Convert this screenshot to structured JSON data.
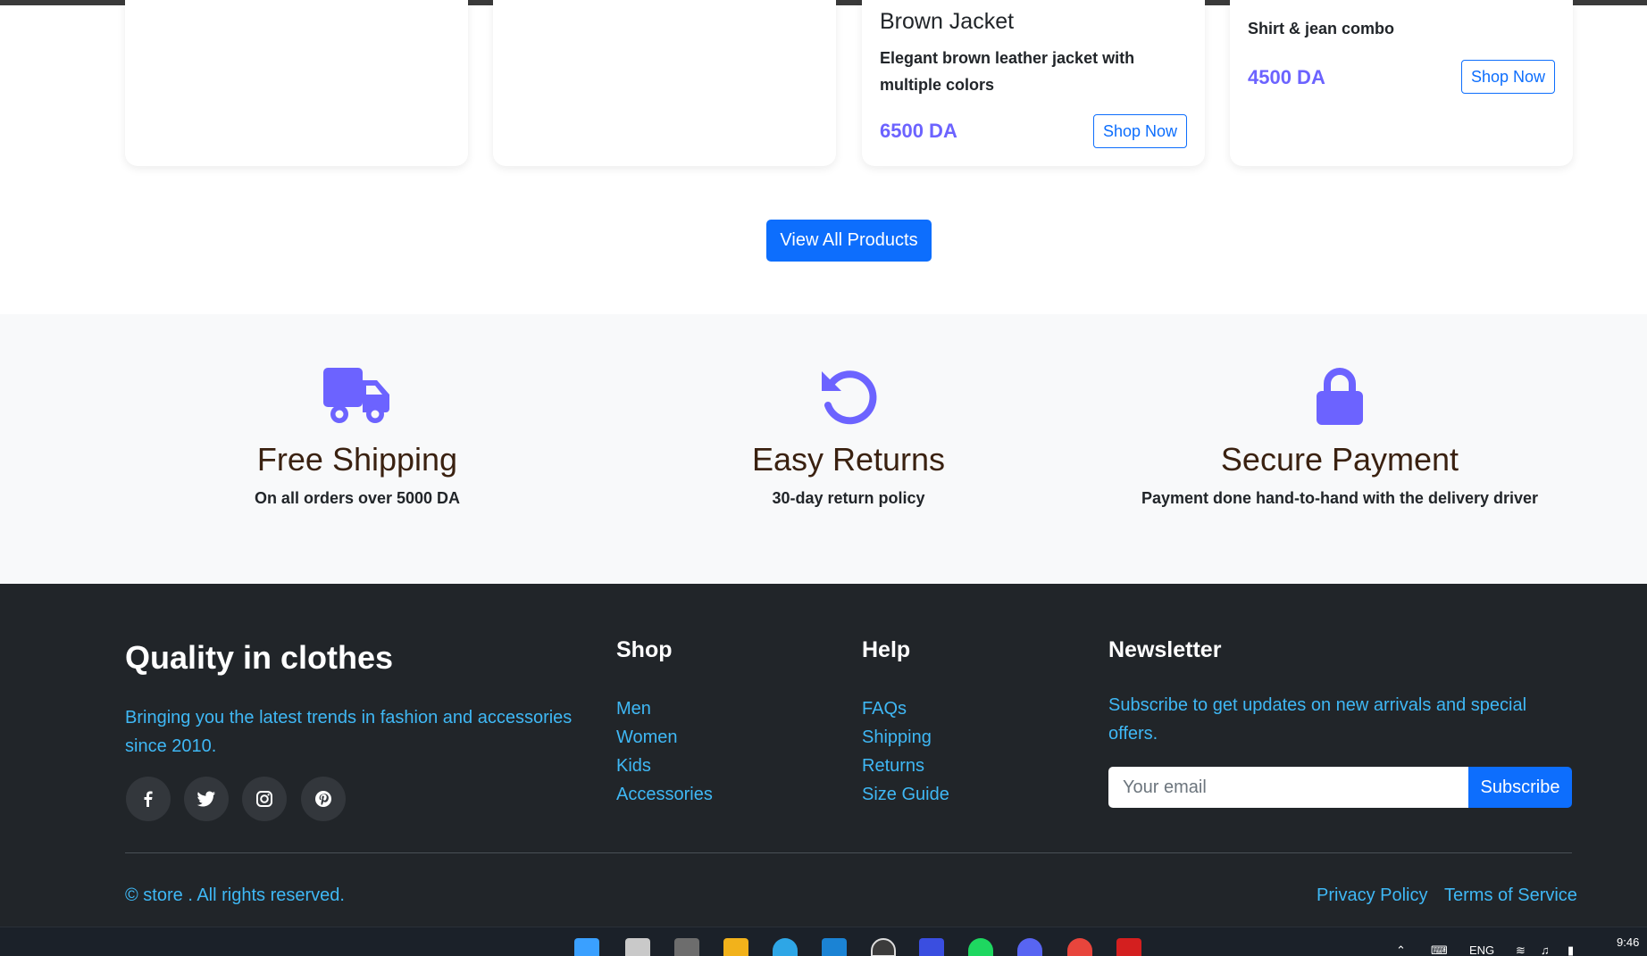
{
  "products": [
    {
      "title": "",
      "description": "",
      "price": "",
      "button": ""
    },
    {
      "title": "",
      "description": "",
      "price": "",
      "button": ""
    },
    {
      "title": "Brown Jacket",
      "description": "Elegant brown leather jacket with multiple colors",
      "price": "6500 DA",
      "button": "Shop Now"
    },
    {
      "title": "Shirt & jean combo",
      "description": "",
      "price": "4500 DA",
      "button": "Shop Now"
    }
  ],
  "view_all_label": "View All Products",
  "features": [
    {
      "icon": "truck-icon",
      "title": "Free Shipping",
      "subtitle": "On all orders over 5000 DA"
    },
    {
      "icon": "undo-icon",
      "title": "Easy Returns",
      "subtitle": "30-day return policy"
    },
    {
      "icon": "lock-icon",
      "title": "Secure Payment",
      "subtitle": "Payment done hand-to-hand with the delivery driver"
    }
  ],
  "footer": {
    "brand": "Quality in clothes",
    "brand_desc": "Bringing you the latest trends in fashion and accessories since 2010.",
    "social": [
      "facebook-icon",
      "twitter-icon",
      "instagram-icon",
      "pinterest-icon"
    ],
    "shop": {
      "heading": "Shop",
      "links": [
        "Men",
        "Women",
        "Kids",
        "Accessories"
      ]
    },
    "help": {
      "heading": "Help",
      "links": [
        "FAQs",
        "Shipping",
        "Returns",
        "Size Guide"
      ]
    },
    "newsletter": {
      "heading": "Newsletter",
      "text": "Subscribe to get updates on new arrivals and special offers.",
      "placeholder": "Your email",
      "button": "Subscribe"
    },
    "copyright": "© store . All rights reserved.",
    "privacy": "Privacy Policy",
    "terms": "Terms of Service"
  },
  "taskbar": {
    "apps": [
      "windows-start-icon",
      "files-icon",
      "app-icon",
      "folder-icon",
      "telegram-icon",
      "vscode-icon",
      "obs-icon",
      "editor-icon",
      "spotify-icon",
      "discord-icon",
      "chrome-icon",
      "acrobat-icon"
    ],
    "language": "ENG",
    "time": "9:46"
  },
  "colors": {
    "accent": "#0d6efd",
    "price": "#6c63ff",
    "footer_bg": "#212529",
    "link": "#3fb8f5",
    "feature_bg": "#f8f9fa"
  }
}
